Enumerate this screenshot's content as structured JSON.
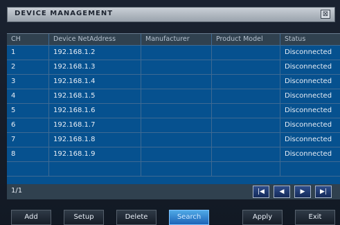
{
  "window": {
    "title": "DEVICE MANAGEMENT",
    "close_glyph": "⊠"
  },
  "table": {
    "headers": [
      "CH",
      "Device NetAddress",
      "Manufacturer",
      "Product Model",
      "Status"
    ],
    "rows": [
      {
        "ch": "1",
        "address": "192.168.1.2",
        "manufacturer": "",
        "model": "",
        "status": "Disconnected"
      },
      {
        "ch": "2",
        "address": "192.168.1.3",
        "manufacturer": "",
        "model": "",
        "status": "Disconnected"
      },
      {
        "ch": "3",
        "address": "192.168.1.4",
        "manufacturer": "",
        "model": "",
        "status": "Disconnected"
      },
      {
        "ch": "4",
        "address": "192.168.1.5",
        "manufacturer": "",
        "model": "",
        "status": "Disconnected"
      },
      {
        "ch": "5",
        "address": "192.168.1.6",
        "manufacturer": "",
        "model": "",
        "status": "Disconnected"
      },
      {
        "ch": "6",
        "address": "192.168.1.7",
        "manufacturer": "",
        "model": "",
        "status": "Disconnected"
      },
      {
        "ch": "7",
        "address": "192.168.1.8",
        "manufacturer": "",
        "model": "",
        "status": "Disconnected"
      },
      {
        "ch": "8",
        "address": "192.168.1.9",
        "manufacturer": "",
        "model": "",
        "status": "Disconnected"
      },
      {
        "ch": "",
        "address": "",
        "manufacturer": "",
        "model": "",
        "status": ""
      }
    ]
  },
  "pager": {
    "page_text": "1/1",
    "first_icon": "first-page-icon",
    "prev_icon": "prev-page-icon",
    "next_icon": "next-page-icon",
    "last_icon": "last-page-icon"
  },
  "buttons": {
    "add": "Add",
    "setup": "Setup",
    "delete": "Delete",
    "search": "Search",
    "apply": "Apply",
    "exit": "Exit"
  },
  "colors": {
    "table_bg": "#06518f",
    "header_bg": "#30414f",
    "active_button": "#3a8fd6"
  }
}
